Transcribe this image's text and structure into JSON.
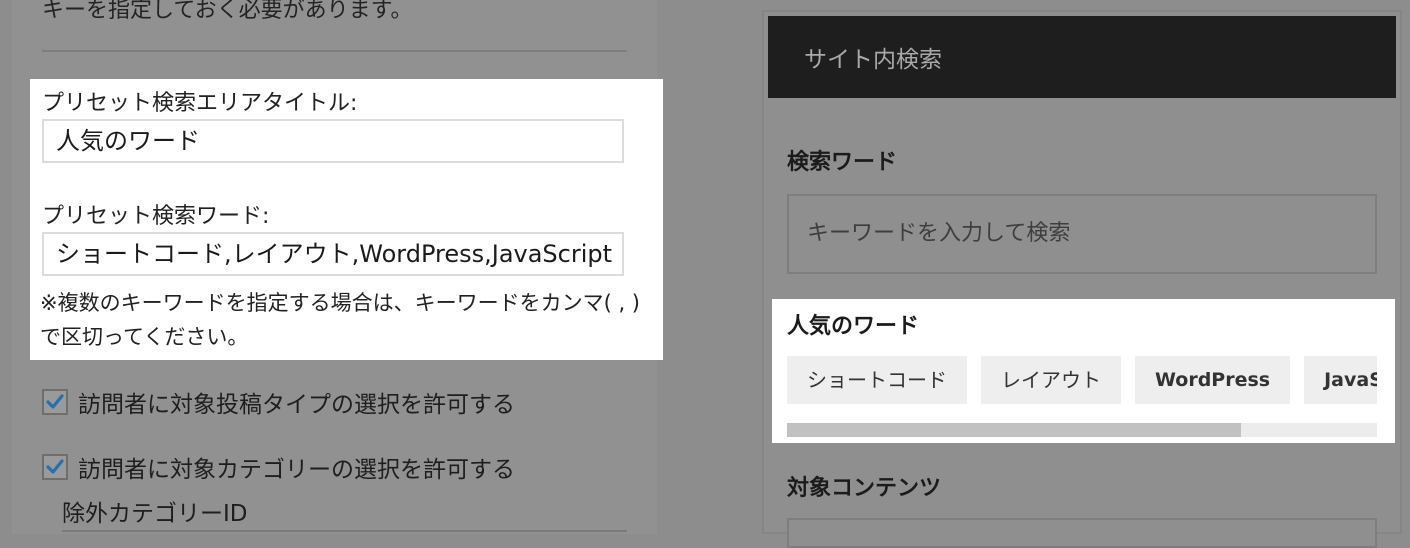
{
  "left": {
    "top_note": "キーを指定しておく必要があります。",
    "preset_title_label": "プリセット検索エリアタイトル:",
    "preset_title_value": "人気のワード",
    "preset_words_label": "プリセット検索ワード:",
    "preset_words_value": "ショートコード,レイアウト,WordPress,JavaScript",
    "preset_words_note": "※複数のキーワードを指定する場合は、キーワードをカンマ( , )で区切ってください。",
    "checkbox_post_type": {
      "label": "訪問者に対象投稿タイプの選択を許可する",
      "checked": true
    },
    "checkbox_category": {
      "label": "訪問者に対象カテゴリーの選択を許可する",
      "checked": true
    },
    "exclude_category_label": "除外カテゴリーID"
  },
  "widget": {
    "title": "サイト内検索",
    "search_heading": "検索ワード",
    "search_placeholder": "キーワードを入力して検索",
    "popular_heading": "人気のワード",
    "tags": [
      "ショートコード",
      "レイアウト",
      "WordPress",
      "JavaScript"
    ],
    "tags_scroll_fraction": 0.77,
    "target_heading": "対象コンテンツ"
  },
  "colors": {
    "overlay_gray": "#8d8d8d",
    "highlight": "#ffffff",
    "header_bg": "#1e1e1e",
    "checkbox_check": "#2271b1"
  }
}
